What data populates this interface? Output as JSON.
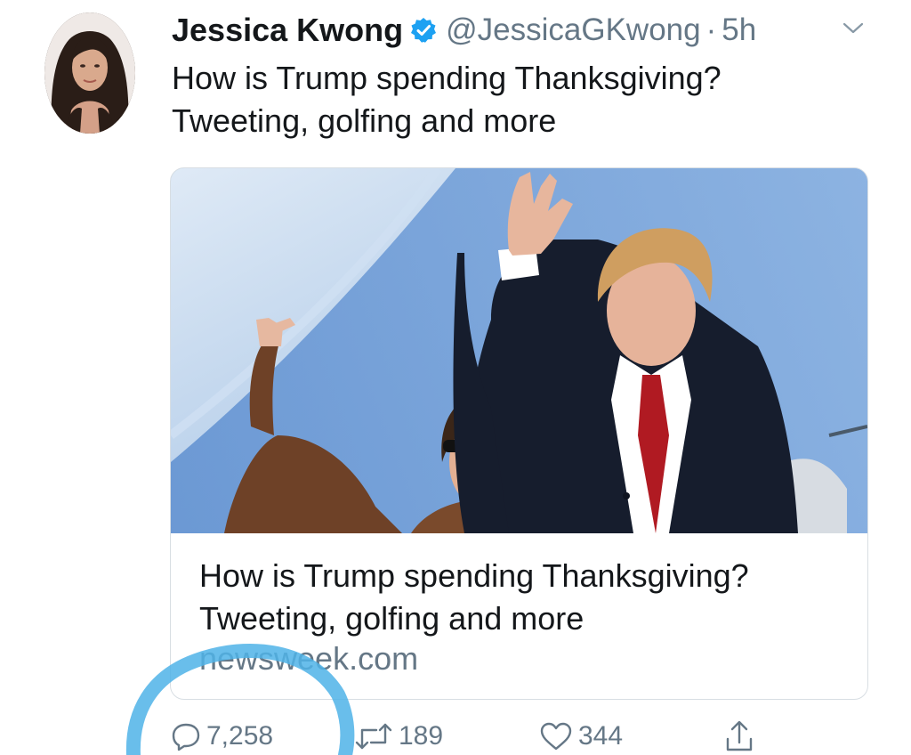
{
  "author": {
    "name": "Jessica Kwong",
    "handle": "@JessicaGKwong",
    "separator": "·",
    "time": "5h",
    "verified": true
  },
  "tweet": {
    "text_line1": "How is Trump spending Thanksgiving?",
    "text_line2": "Tweeting, golfing and more"
  },
  "card": {
    "title_line1": "How is Trump spending Thanksgiving?",
    "title_line2": "Tweeting, golfing and more",
    "domain": "newsweek.com"
  },
  "actions": {
    "reply_count": "7,258",
    "retweet_count": "189",
    "like_count": "344"
  },
  "icons": {
    "verified": "verified-badge-icon",
    "caret": "chevron-down-icon",
    "reply": "reply-icon",
    "retweet": "retweet-icon",
    "like": "heart-icon",
    "share": "share-icon"
  },
  "colors": {
    "text": "#14171a",
    "secondary": "#657786",
    "verified": "#1da1f2",
    "annotation": "#4fb3e8"
  }
}
